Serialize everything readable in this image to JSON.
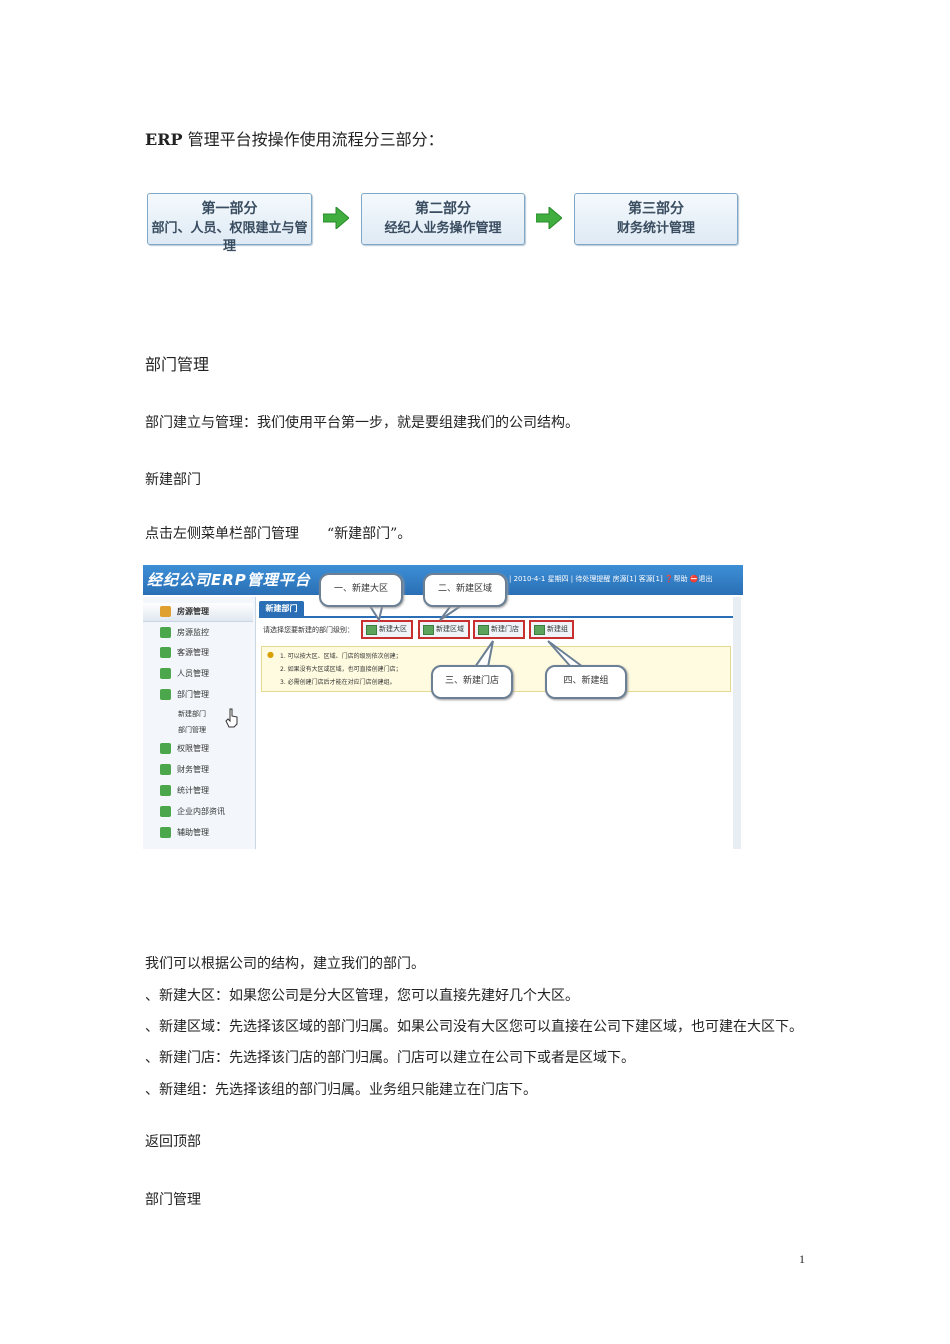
{
  "intro": {
    "bold": "ERP",
    "rest": " 管理平台按操作使用流程分三部分："
  },
  "flow": [
    {
      "line1": "第一部分",
      "line2": "部门、人员、权限建立与管理"
    },
    {
      "line1": "第二部分",
      "line2": "经纪人业务操作管理"
    },
    {
      "line1": "第三部分",
      "line2": "财务统计管理"
    }
  ],
  "section1_title": "部门管理",
  "para1": "部门建立与管理：我们使用平台第一步，就是要组建我们的公司结构。",
  "sub_title": "新建部门",
  "para2": "点击左侧菜单栏部门管理　　“新建部门”。",
  "screenshot": {
    "title": "经纪公司ERP管理平台",
    "status": "| 2010-4-1 星期四 | 待处理提醒 房源[1] 客源[1] ❓帮助 ⛔退出",
    "sidebar_head": "房源管理",
    "sidebar_items": [
      "房源监控",
      "客源管理",
      "人员管理",
      "部门管理"
    ],
    "sidebar_sub": [
      "新建部门",
      "部门管理"
    ],
    "sidebar_items2": [
      "权限管理",
      "财务管理",
      "统计管理",
      "企业内部资讯",
      "辅助管理"
    ],
    "tab": "新建部门",
    "prompt": "请选择您要新建的部门级别：",
    "buttons": [
      "新建大区",
      "新建区域",
      "新建门店",
      "新建组"
    ],
    "tips": [
      "1. 可以按大区、区域、门店的级别依次创建；",
      "2. 如果没有大区或区域，也可直接创建门店；",
      "3. 必需创建门店后才能在对应门店创建组。"
    ],
    "callouts": [
      "一、新建大区",
      "二、新建区域",
      "三、新建门店",
      "四、新建组"
    ]
  },
  "para3": "我们可以根据公司的结构，建立我们的部门。",
  "list": [
    "、新建大区：如果您公司是分大区管理，您可以直接先建好几个大区。",
    "、新建区域：先选择该区域的部门归属。如果公司没有大区您可以直接在公司下建区域，也可建在大区下。",
    "、新建门店：先选择该门店的部门归属。门店可以建立在公司下或者是区域下。",
    "、新建组：先选择该组的部门归属。业务组只能建立在门店下。"
  ],
  "back_to_top": "返回顶部",
  "section2_title": "部门管理",
  "page_number": "1",
  "colors": {
    "accent": "#2a6fb5",
    "highlight": "#c83030",
    "arrow": "#3fae3f"
  }
}
